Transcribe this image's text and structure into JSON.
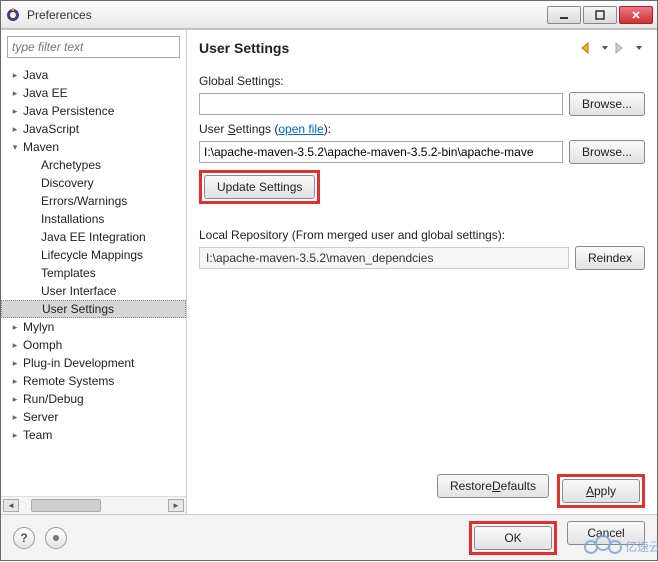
{
  "window": {
    "title": "Preferences"
  },
  "filter": {
    "placeholder": "type filter text"
  },
  "tree": [
    {
      "label": "Java",
      "depth": 0,
      "expand": "closed"
    },
    {
      "label": "Java EE",
      "depth": 0,
      "expand": "closed"
    },
    {
      "label": "Java Persistence",
      "depth": 0,
      "expand": "closed"
    },
    {
      "label": "JavaScript",
      "depth": 0,
      "expand": "closed"
    },
    {
      "label": "Maven",
      "depth": 0,
      "expand": "open"
    },
    {
      "label": "Archetypes",
      "depth": 1,
      "expand": "none"
    },
    {
      "label": "Discovery",
      "depth": 1,
      "expand": "none"
    },
    {
      "label": "Errors/Warnings",
      "depth": 1,
      "expand": "none"
    },
    {
      "label": "Installations",
      "depth": 1,
      "expand": "none"
    },
    {
      "label": "Java EE Integration",
      "depth": 1,
      "expand": "none"
    },
    {
      "label": "Lifecycle Mappings",
      "depth": 1,
      "expand": "none"
    },
    {
      "label": "Templates",
      "depth": 1,
      "expand": "none"
    },
    {
      "label": "User Interface",
      "depth": 1,
      "expand": "none"
    },
    {
      "label": "User Settings",
      "depth": 1,
      "expand": "none",
      "selected": true
    },
    {
      "label": "Mylyn",
      "depth": 0,
      "expand": "closed"
    },
    {
      "label": "Oomph",
      "depth": 0,
      "expand": "closed"
    },
    {
      "label": "Plug-in Development",
      "depth": 0,
      "expand": "closed"
    },
    {
      "label": "Remote Systems",
      "depth": 0,
      "expand": "closed"
    },
    {
      "label": "Run/Debug",
      "depth": 0,
      "expand": "closed"
    },
    {
      "label": "Server",
      "depth": 0,
      "expand": "closed"
    },
    {
      "label": "Team",
      "depth": 0,
      "expand": "closed"
    }
  ],
  "page": {
    "title": "User Settings",
    "globalSettingsLabel": "Global Settings:",
    "globalSettingsValue": "",
    "browse1": "Browse...",
    "userSettingsLabelPrefix": "User ",
    "userSettingsLabelRest": "ettings (",
    "userSettingsLabelS": "S",
    "openFile": "open file",
    "userSettingsLabelSuffix": "):",
    "userSettingsValue": "I:\\apache-maven-3.5.2\\apache-maven-3.5.2-bin\\apache-mave",
    "browse2": "Browse...",
    "updateSettings": "Update Settings",
    "localRepoLabel": "Local Repository (From merged user and global settings):",
    "localRepoValue": "I:\\apache-maven-3.5.2\\maven_dependcies",
    "reindex": "Reindex",
    "restoreDefaults": "Restore ",
    "restoreDefaultsD": "D",
    "restoreDefaultsRest": "efaults",
    "apply": "Apply",
    "applyA": "A"
  },
  "footer": {
    "ok": "OK",
    "cancel": "Cancel"
  },
  "watermark": "亿速云"
}
